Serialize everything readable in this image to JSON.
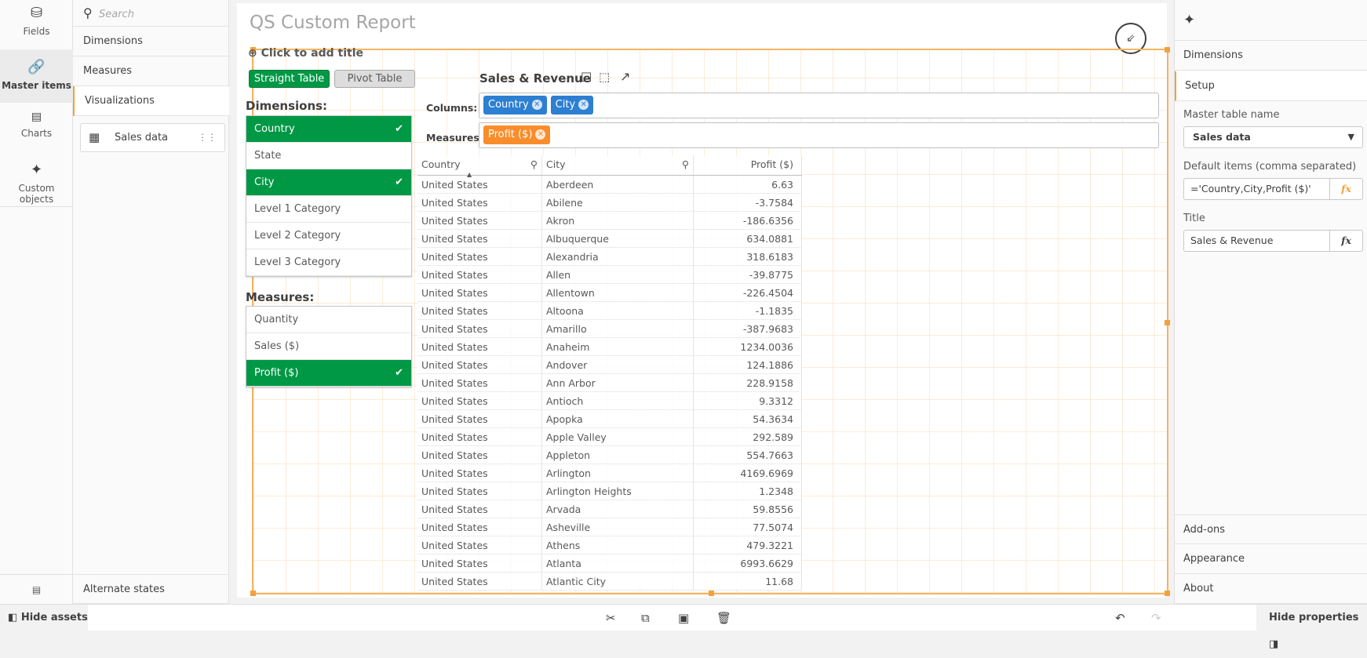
{
  "iconbar": {
    "items": [
      {
        "label": "Fields",
        "icon": "database-icon"
      },
      {
        "label": "Master items",
        "icon": "link-icon"
      },
      {
        "label": "Charts",
        "icon": "bar-chart-icon"
      },
      {
        "label": "Custom objects",
        "icon": "puzzle-icon"
      }
    ]
  },
  "assets": {
    "search_placeholder": "Search",
    "sections": [
      "Dimensions",
      "Measures",
      "Visualizations"
    ],
    "item": "Sales data",
    "alternate_states": "Alternate states"
  },
  "sheet": {
    "title": "QS Custom Report",
    "add_title": "Click to add title"
  },
  "extension": {
    "buttons": {
      "straight": "Straight Table",
      "pivot": "Pivot Table"
    },
    "dimensions_label": "Dimensions:",
    "dimensions": [
      {
        "label": "Country",
        "selected": true
      },
      {
        "label": "State",
        "selected": false
      },
      {
        "label": "City",
        "selected": true
      },
      {
        "label": "Level 1 Category",
        "selected": false
      },
      {
        "label": "Level 2 Category",
        "selected": false
      },
      {
        "label": "Level 3 Category",
        "selected": false
      }
    ],
    "measures_label": "Measures:",
    "measures": [
      {
        "label": "Quantity",
        "selected": false
      },
      {
        "label": "Sales ($)",
        "selected": false
      },
      {
        "label": "Profit ($)",
        "selected": true
      }
    ],
    "table_title": "Sales & Revenue",
    "columns_label": "Columns:",
    "column_chips": [
      "Country",
      "City"
    ],
    "measures_box_label": "Measures:",
    "measure_chips": [
      "Profit ($)"
    ],
    "colors": {
      "green": "#009845",
      "blue": "#2d7fd2",
      "orange": "#f98d2b",
      "accent": "#f4a13d"
    }
  },
  "table": {
    "headers": [
      "Country",
      "City",
      "Profit ($)"
    ],
    "rows": [
      [
        "United States",
        "Aberdeen",
        "6.63"
      ],
      [
        "United States",
        "Abilene",
        "-3.7584"
      ],
      [
        "United States",
        "Akron",
        "-186.6356"
      ],
      [
        "United States",
        "Albuquerque",
        "634.0881"
      ],
      [
        "United States",
        "Alexandria",
        "318.6183"
      ],
      [
        "United States",
        "Allen",
        "-39.8775"
      ],
      [
        "United States",
        "Allentown",
        "-226.4504"
      ],
      [
        "United States",
        "Altoona",
        "-1.1835"
      ],
      [
        "United States",
        "Amarillo",
        "-387.9683"
      ],
      [
        "United States",
        "Anaheim",
        "1234.0036"
      ],
      [
        "United States",
        "Andover",
        "124.1886"
      ],
      [
        "United States",
        "Ann Arbor",
        "228.9158"
      ],
      [
        "United States",
        "Antioch",
        "9.3312"
      ],
      [
        "United States",
        "Apopka",
        "54.3634"
      ],
      [
        "United States",
        "Apple Valley",
        "292.589"
      ],
      [
        "United States",
        "Appleton",
        "554.7663"
      ],
      [
        "United States",
        "Arlington",
        "4169.6969"
      ],
      [
        "United States",
        "Arlington Heights",
        "1.2348"
      ],
      [
        "United States",
        "Arvada",
        "59.8556"
      ],
      [
        "United States",
        "Asheville",
        "77.5074"
      ],
      [
        "United States",
        "Athens",
        "479.3221"
      ],
      [
        "United States",
        "Atlanta",
        "6993.6629"
      ],
      [
        "United States",
        "Atlantic City",
        "11.68"
      ]
    ]
  },
  "props": {
    "sections_top": [
      "Dimensions",
      "Setup"
    ],
    "master_table_label": "Master table name",
    "master_table_value": "Sales data",
    "default_items_label": "Default items (comma separated)",
    "default_items_value": "='Country,City,Profit ($)'",
    "title_label": "Title",
    "title_value": "Sales & Revenue",
    "fx": "fx",
    "sections_bottom": [
      "Add-ons",
      "Appearance",
      "About"
    ]
  },
  "bottom": {
    "hide_assets": "Hide assets",
    "hide_properties": "Hide properties"
  }
}
